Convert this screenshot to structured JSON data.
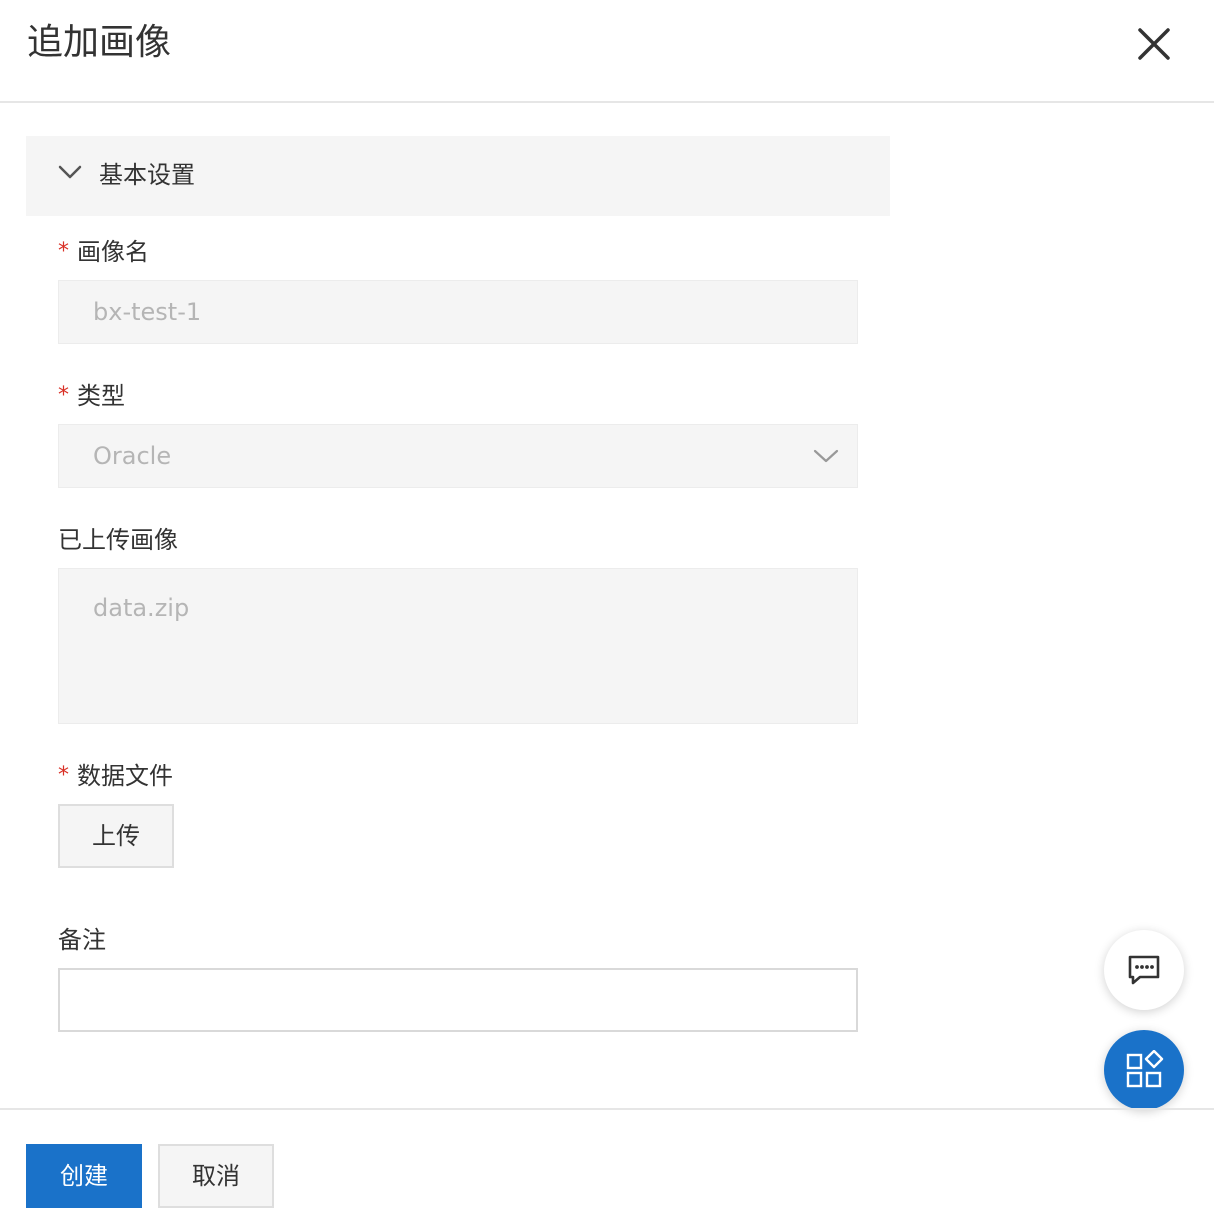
{
  "dialog": {
    "title": "追加画像"
  },
  "section": {
    "title": "基本设置"
  },
  "fields": {
    "required_mark": "*",
    "image_name": {
      "label": "画像名",
      "value": "bx-test-1"
    },
    "type": {
      "label": "类型",
      "value": "Oracle"
    },
    "uploaded_image": {
      "label": "已上传画像",
      "value": "data.zip"
    },
    "data_file": {
      "label": "数据文件",
      "button_label": "上传"
    },
    "remark": {
      "label": "备注",
      "value": ""
    }
  },
  "footer": {
    "create_label": "创建",
    "cancel_label": "取消"
  },
  "icons": {
    "close": "close-icon",
    "section_toggle": "chevron-down-icon",
    "select_toggle": "chevron-down-icon",
    "chat": "chat-icon",
    "apps": "apps-icon"
  },
  "colors": {
    "primary": "#1a72c9",
    "required": "#d93026",
    "disabled_bg": "#f5f5f5",
    "disabled_text": "#b5b5b5"
  }
}
